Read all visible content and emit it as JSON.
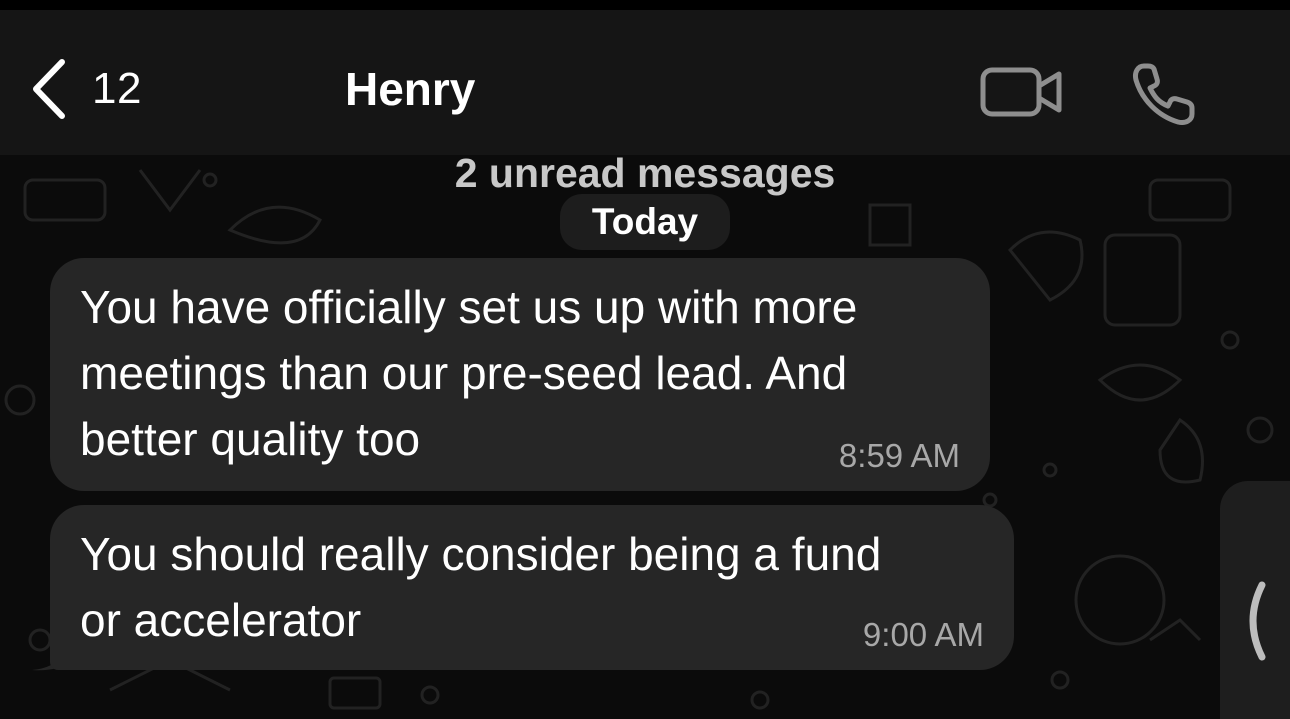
{
  "header": {
    "back_count": "12",
    "contact_name": "Henry",
    "icons": {
      "back": "chevron-left-icon",
      "video": "video-camera-icon",
      "call": "phone-icon"
    }
  },
  "chat": {
    "unread_banner": "2 unread messages",
    "date_label": "Today",
    "messages": [
      {
        "text": "You have officially set us up with more\nmeetings than our pre-seed lead. And\nbetter quality too",
        "time": "8:59 AM",
        "direction": "incoming"
      },
      {
        "text": "You should really consider being a fund\nor accelerator",
        "time": "9:00 AM",
        "direction": "incoming"
      }
    ]
  },
  "side_panel": {
    "icon": "chevron-left-icon"
  },
  "colors": {
    "background": "#0b0b0b",
    "header": "#151515",
    "bubble": "#262626",
    "timestamp": "#a8a8a8",
    "banner_text": "#c8c8c8"
  }
}
